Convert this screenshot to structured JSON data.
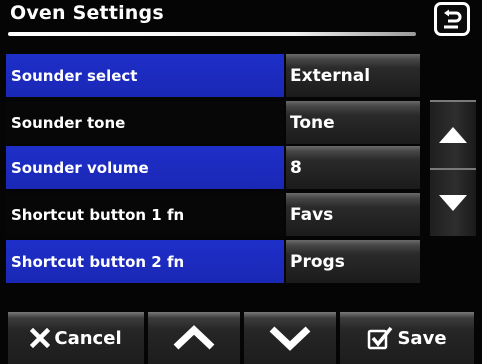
{
  "header": {
    "title": "Oven Settings",
    "back_icon": "return-arrow-icon"
  },
  "rows": [
    {
      "label": "Sounder select",
      "value": "External",
      "highlighted": true
    },
    {
      "label": "Sounder tone",
      "value": "Tone",
      "highlighted": false
    },
    {
      "label": "Sounder volume",
      "value": "8",
      "highlighted": true
    },
    {
      "label": "Shortcut button 1 fn",
      "value": "Favs",
      "highlighted": false
    },
    {
      "label": "Shortcut button 2 fn",
      "value": "Progs",
      "highlighted": true
    }
  ],
  "scroll": {
    "up_icon": "triangle-up-icon",
    "down_icon": "triangle-down-icon"
  },
  "footer": {
    "cancel_label": "Cancel",
    "cancel_icon": "x-icon",
    "up_icon": "chevron-up-icon",
    "down_icon": "chevron-down-icon",
    "save_label": "Save",
    "save_icon": "checkbox-check-icon"
  },
  "colors": {
    "accent_blue": "#1e2fc9",
    "background": "#050505",
    "text": "#ffffff"
  }
}
